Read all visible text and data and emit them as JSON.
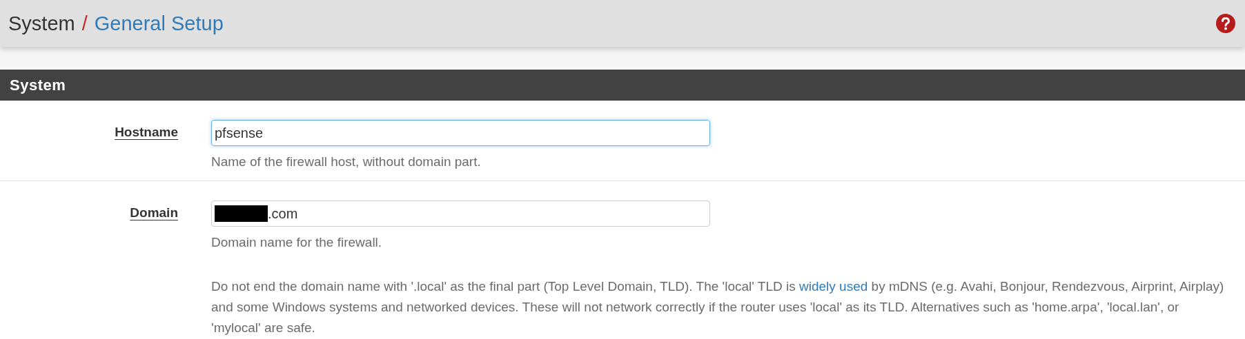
{
  "breadcrumb": [
    {
      "text": "System",
      "kind": "plain"
    },
    {
      "text": "General Setup",
      "kind": "link"
    }
  ],
  "separator": "/",
  "section": {
    "title": "System"
  },
  "fields": [
    {
      "label": "Hostname",
      "value": "pfsense",
      "focused": true,
      "redacted": false,
      "help": [
        {
          "kind": "text",
          "parts": [
            {
              "text": "Name of the firewall host, without domain part."
            }
          ]
        }
      ]
    },
    {
      "label": "Domain",
      "value": ".com",
      "focused": false,
      "redacted": true,
      "help": [
        {
          "kind": "text",
          "parts": [
            {
              "text": "Domain name for the firewall."
            }
          ]
        },
        {
          "kind": "text",
          "parts": [
            {
              "text": "Do not end the domain name with '.local' as the final part (Top Level Domain, TLD). The 'local' TLD is "
            },
            {
              "text": "widely used",
              "link": true
            },
            {
              "text": " by mDNS (e.g. Avahi, Bonjour, Rendezvous, Airprint, Airplay) and some Windows systems and networked devices. These will not network correctly if the router uses 'local' as its TLD. Alternatives such as 'home.arpa', 'local.lan', or 'mylocal' are safe."
            }
          ]
        }
      ]
    }
  ]
}
